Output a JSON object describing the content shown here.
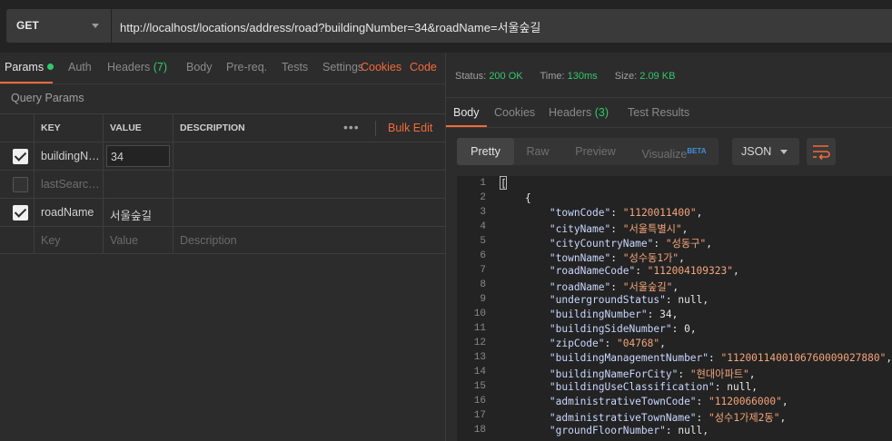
{
  "request": {
    "method": "GET",
    "url": "http://localhost/locations/address/road?buildingNumber=34&roadName=서울숲길"
  },
  "request_tabs": {
    "params": "Params",
    "auth": "Auth",
    "headers": "Headers",
    "headers_count": "(7)",
    "body": "Body",
    "prereq": "Pre-req.",
    "tests": "Tests",
    "settings": "Settings",
    "cookies": "Cookies",
    "code": "Code"
  },
  "query_params": {
    "title": "Query Params",
    "columns": {
      "key": "KEY",
      "value": "VALUE",
      "description": "DESCRIPTION"
    },
    "bulk_edit": "Bulk Edit",
    "more": "•••",
    "rows": [
      {
        "checked": true,
        "key": "buildingNumber",
        "value": "34",
        "description": ""
      },
      {
        "checked": false,
        "key": "lastSearchedAddress",
        "value": "",
        "description": ""
      },
      {
        "checked": true,
        "key": "roadName",
        "value": "서울숲길",
        "description": ""
      }
    ],
    "placeholder": {
      "key": "Key",
      "value": "Value",
      "description": "Description"
    }
  },
  "response": {
    "status_label": "Status:",
    "status_value": "200 OK",
    "time_label": "Time:",
    "time_value": "130ms",
    "size_label": "Size:",
    "size_value": "2.09 KB",
    "tabs": {
      "body": "Body",
      "cookies": "Cookies",
      "headers": "Headers",
      "headers_count": "(3)",
      "test_results": "Test Results"
    },
    "view_modes": {
      "pretty": "Pretty",
      "raw": "Raw",
      "preview": "Preview",
      "visualize": "Visualize",
      "beta": "BETA"
    },
    "format": "JSON",
    "wrap_icon": "wrap-lines-icon",
    "lines": [
      {
        "n": "1",
        "text": "["
      },
      {
        "n": "2",
        "text": "    {"
      },
      {
        "n": "3",
        "key": "townCode",
        "val": "\"1120011400\"",
        "type": "s"
      },
      {
        "n": "4",
        "key": "cityName",
        "val": "\"서울특별시\"",
        "type": "s"
      },
      {
        "n": "5",
        "key": "cityCountryName",
        "val": "\"성동구\"",
        "type": "s"
      },
      {
        "n": "6",
        "key": "townName",
        "val": "\"성수동1가\"",
        "type": "s"
      },
      {
        "n": "7",
        "key": "roadNameCode",
        "val": "\"112004109323\"",
        "type": "s"
      },
      {
        "n": "8",
        "key": "roadName",
        "val": "\"서울숲길\"",
        "type": "s"
      },
      {
        "n": "9",
        "key": "undergroundStatus",
        "val": "null",
        "type": "n"
      },
      {
        "n": "10",
        "key": "buildingNumber",
        "val": "34",
        "type": "n"
      },
      {
        "n": "11",
        "key": "buildingSideNumber",
        "val": "0",
        "type": "n"
      },
      {
        "n": "12",
        "key": "zipCode",
        "val": "\"04768\"",
        "type": "s"
      },
      {
        "n": "13",
        "key": "buildingManagementNumber",
        "val": "\"1120011400106760009027880\"",
        "type": "s"
      },
      {
        "n": "14",
        "key": "buildingNameForCity",
        "val": "\"현대아파트\"",
        "type": "s"
      },
      {
        "n": "15",
        "key": "buildingUseClassification",
        "val": "null",
        "type": "n"
      },
      {
        "n": "16",
        "key": "administrativeTownCode",
        "val": "\"1120066000\"",
        "type": "s"
      },
      {
        "n": "17",
        "key": "administrativeTownName",
        "val": "\"성수1가제2동\"",
        "type": "s"
      },
      {
        "n": "18",
        "key": "groundFloorNumber",
        "val": "null",
        "type": "n"
      }
    ]
  },
  "colors": {
    "accent": "#f26b3a",
    "success": "#30c96c",
    "string": "#f4a57a",
    "key": "#c9d7ff",
    "beta": "#3b8fe0"
  }
}
